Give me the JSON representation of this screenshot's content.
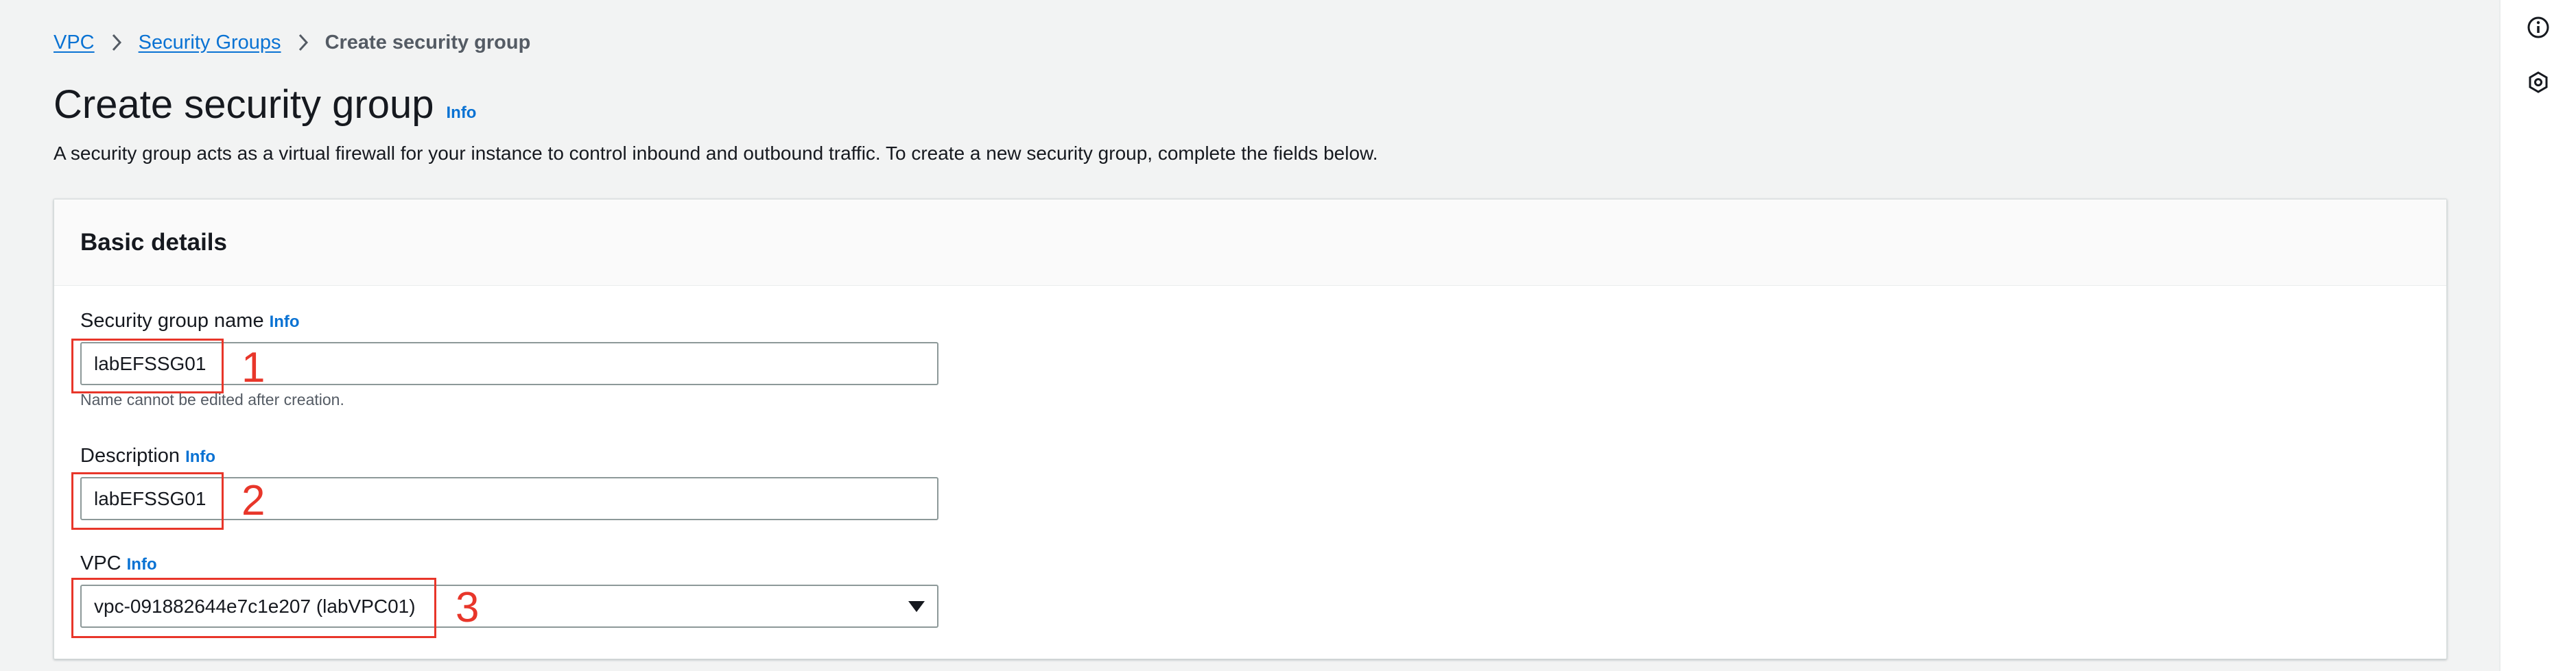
{
  "breadcrumb": {
    "items": [
      {
        "label": "VPC",
        "type": "link"
      },
      {
        "label": "Security Groups",
        "type": "link"
      },
      {
        "label": "Create security group",
        "type": "current"
      }
    ]
  },
  "header": {
    "title": "Create security group",
    "info": "Info",
    "description": "A security group acts as a virtual firewall for your instance to control inbound and outbound traffic. To create a new security group, complete the fields below."
  },
  "basic_details": {
    "title": "Basic details",
    "fields": {
      "name": {
        "label": "Security group name",
        "info": "Info",
        "value": "labEFSSG01",
        "constraint": "Name cannot be edited after creation."
      },
      "description": {
        "label": "Description",
        "info": "Info",
        "value": "labEFSSG01"
      },
      "vpc": {
        "label": "VPC",
        "info": "Info",
        "selected": "vpc-091882644e7c1e207 (labVPC01)"
      }
    }
  },
  "annotations": {
    "n1": "1",
    "n2": "2",
    "n3": "3",
    "color": "#e8362a"
  },
  "right_rail": {
    "icons": [
      "info-icon",
      "settings-hexagon-icon"
    ]
  },
  "colors": {
    "link": "#0972d3",
    "background": "#f2f3f3",
    "text": "#16191f"
  }
}
